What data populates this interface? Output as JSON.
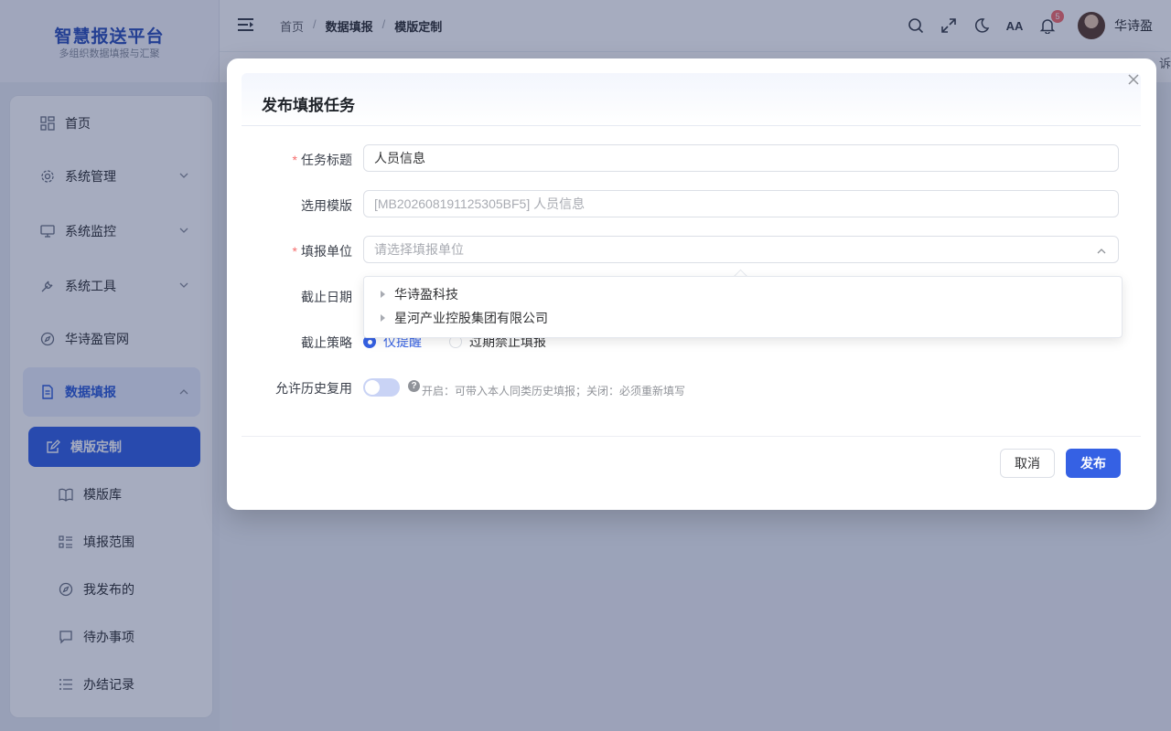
{
  "app": {
    "title": "智慧报送平台",
    "subtitle": "多组织数据填报与汇聚"
  },
  "header": {
    "breadcrumb": [
      "首页",
      "数据填报",
      "模版定制"
    ],
    "notification_count": "5",
    "font_size_label": "AA",
    "username": "华诗盈",
    "subbar_text": "诉"
  },
  "sidebar": {
    "items": [
      {
        "label": "首页",
        "icon": "dashboard-icon"
      },
      {
        "label": "系统管理",
        "icon": "gear-icon"
      },
      {
        "label": "系统监控",
        "icon": "monitor-icon"
      },
      {
        "label": "系统工具",
        "icon": "wrench-icon"
      },
      {
        "label": "华诗盈官网",
        "icon": "compass-icon"
      },
      {
        "label": "数据填报",
        "icon": "document-icon"
      }
    ],
    "sub_items": [
      {
        "label": "模版定制",
        "icon": "edit-icon"
      },
      {
        "label": "模版库",
        "icon": "book-icon"
      },
      {
        "label": "填报范围",
        "icon": "list-grid-icon"
      },
      {
        "label": "我发布的",
        "icon": "compass-icon"
      },
      {
        "label": "待办事项",
        "icon": "chat-icon"
      },
      {
        "label": "办结记录",
        "icon": "list-icon"
      }
    ]
  },
  "dialog": {
    "title": "发布填报任务",
    "fields": {
      "task_title": {
        "label": "任务标题",
        "value": "人员信息"
      },
      "template": {
        "label": "选用模版",
        "value": "[MB202608191125305BF5] 人员信息"
      },
      "units": {
        "label": "填报单位",
        "placeholder": "请选择填报单位"
      },
      "deadline": {
        "label": "截止日期"
      },
      "policy": {
        "label": "截止策略",
        "options": [
          "仅提醒",
          "过期禁止填报"
        ],
        "selected": "仅提醒"
      },
      "history": {
        "label": "允许历史复用",
        "hint": "开启：可带入本人同类历史填报；关闭：必须重新填写",
        "enabled": false
      }
    },
    "tree_options": [
      "华诗盈科技",
      "星河产业控股集团有限公司"
    ],
    "buttons": {
      "cancel": "取消",
      "submit": "发布"
    }
  }
}
